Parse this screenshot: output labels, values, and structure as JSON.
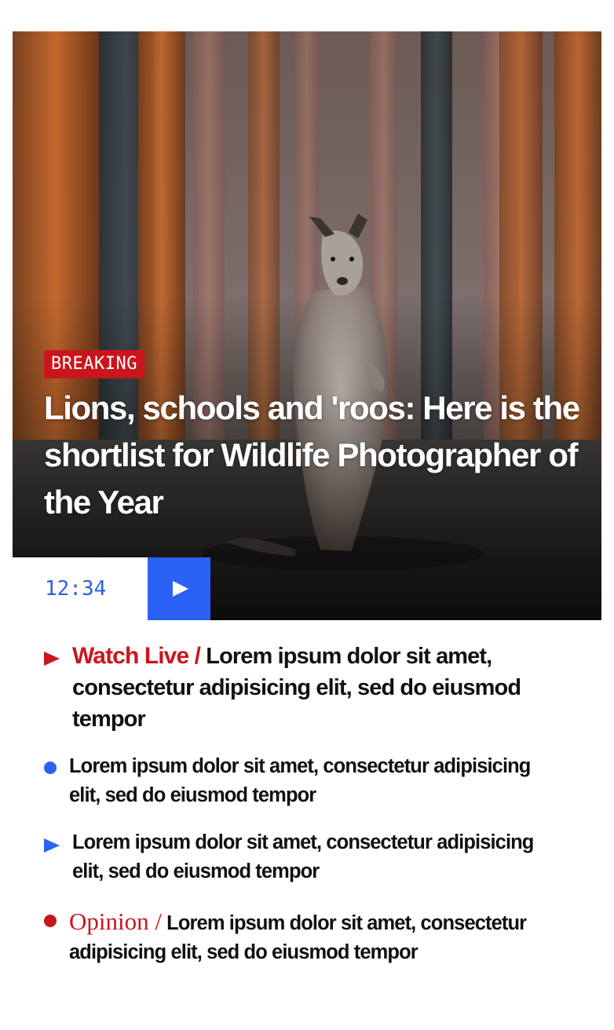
{
  "hero": {
    "badge": "BREAKING",
    "headline": "Lions, schools and 'roos: Here is the shortlist for Wildlife Photographer of the Year",
    "time": "12:34",
    "image_subject": "kangaroo-in-burnt-forest-photo"
  },
  "colors": {
    "accent_red": "#c9161d",
    "accent_blue": "#2b62f5",
    "time_blue": "#2f5fe0",
    "text": "#111111"
  },
  "items": [
    {
      "marker": "play-triangle-icon",
      "kicker": "Watch Live /",
      "text": " Lorem ipsum dolor sit amet, consectetur adipisicing elit, sed do eiusmod tempor"
    },
    {
      "marker": "blue-dot-icon",
      "text": "Lorem ipsum dolor sit amet, consectetur adipisicing elit, sed do eiusmod tempor"
    },
    {
      "marker": "blue-triangle-icon",
      "text": "Lorem ipsum dolor sit amet, consectetur adipisicing elit, sed do eiusmod tempor"
    },
    {
      "marker": "red-dot-icon",
      "kicker": "Opinion /",
      "text": " Lorem ipsum dolor sit amet, consectetur adipisicing elit, sed do eiusmod tempor"
    }
  ]
}
